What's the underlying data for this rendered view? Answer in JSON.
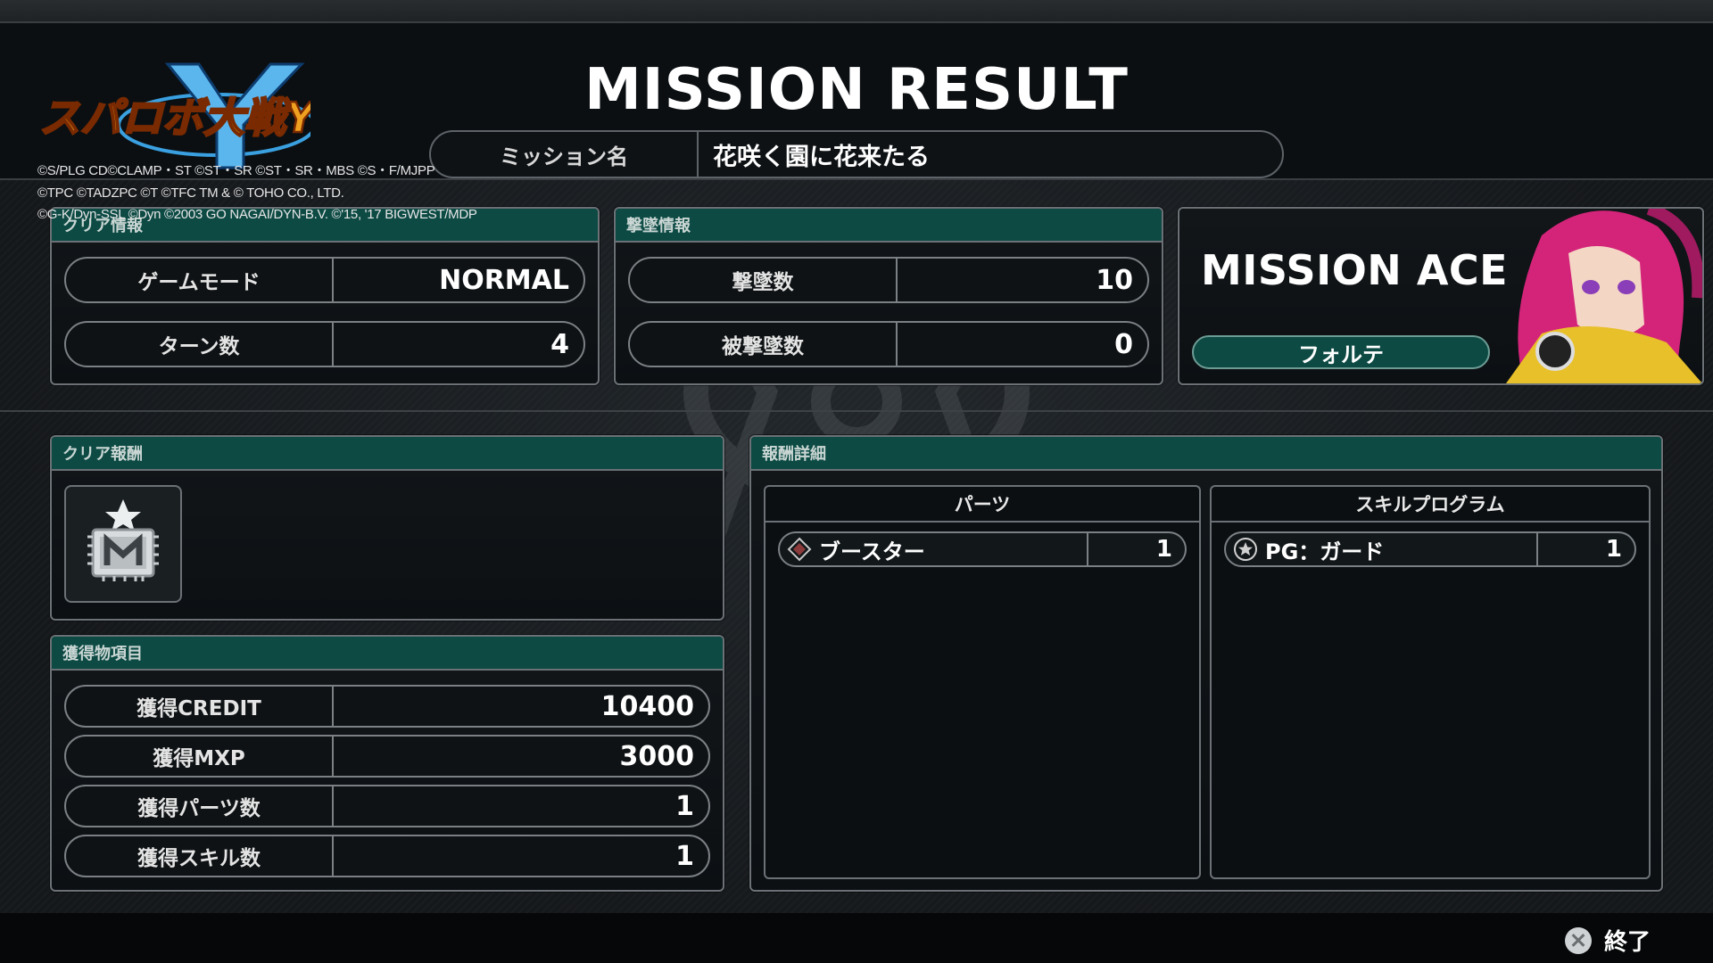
{
  "header": {
    "title": "MISSION RESULT",
    "logo_text": "スパロボ大戦Y",
    "mission_label": "ミッション名",
    "mission_value": "花咲く園に花来たる"
  },
  "copyright": [
    "©S/PLG CD©CLAMP・ST ©ST・SR ©ST・SR・MBS ©S・F/MJPP",
    "©TPC ©TADZPC ©T ©TFC TM & © TOHO CO., LTD.",
    "©G-K/Dyn-SSL ©Dyn ©2003 GO NAGAI/DYN-B.V. ©'15, '17 BIGWEST/MDP"
  ],
  "clear_info": {
    "header": "クリア情報",
    "rows": [
      {
        "label": "ゲームモード",
        "value": "NORMAL"
      },
      {
        "label": "ターン数",
        "value": "4"
      }
    ]
  },
  "kill_info": {
    "header": "撃墜情報",
    "rows": [
      {
        "label": "撃墜数",
        "value": "10"
      },
      {
        "label": "被撃墜数",
        "value": "0"
      }
    ]
  },
  "ace": {
    "title": "MISSION ACE",
    "name": "フォルテ"
  },
  "clear_reward": {
    "header": "クリア報酬",
    "icon": "medal-m-icon"
  },
  "acquired": {
    "header": "獲得物項目",
    "rows": [
      {
        "label": "獲得CREDIT",
        "value": "10400"
      },
      {
        "label": "獲得MXP",
        "value": "3000"
      },
      {
        "label": "獲得パーツ数",
        "value": "1"
      },
      {
        "label": "獲得スキル数",
        "value": "1"
      }
    ]
  },
  "reward_detail": {
    "header": "報酬詳細",
    "parts": {
      "header": "パーツ",
      "items": [
        {
          "icon": "diamond-icon",
          "name": "ブースター",
          "count": "1"
        }
      ]
    },
    "skills": {
      "header": "スキルプログラム",
      "items": [
        {
          "icon": "star-circle-icon",
          "name": "PG：ガード",
          "count": "1"
        }
      ]
    }
  },
  "footer": {
    "button_icon": "cross-button-icon",
    "button_label": "終了"
  },
  "colors": {
    "panel_header": "#0d4a44",
    "background": "#15181b",
    "accent_logo": "#3aa0e0"
  }
}
